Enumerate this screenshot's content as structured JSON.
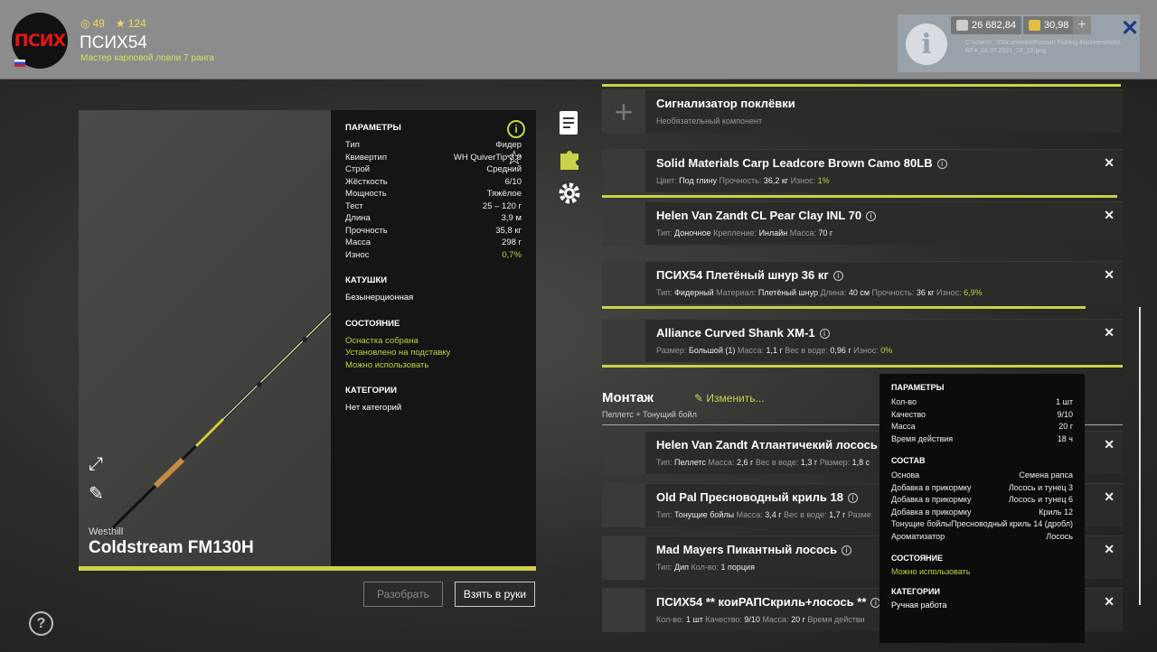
{
  "header": {
    "avatar_text": "ПСИХ",
    "coins": "49",
    "stars": "124",
    "player_name": "ПСИХ54",
    "rank_text": "Мастер карповой ловли 7 ранга",
    "silver": "26 682,84",
    "gold": "30,98",
    "plus": "+",
    "close": "✕",
    "info_glyph": "i",
    "path_text": "C:\\Users\\...\\Documents\\Russian Fishing 4\\screenshots\\ RF4_28.07.2021_18_19.png"
  },
  "rod": {
    "brand": "Westhill",
    "model": "Coldstream FM130H",
    "params_title": "ПАРАМЕТРЫ",
    "params": [
      {
        "k": "Тип",
        "v": "Фидер"
      },
      {
        "k": "Квивертип",
        "v": "WH QuiverTip 3.0"
      },
      {
        "k": "Строй",
        "v": "Средний"
      },
      {
        "k": "Жёсткость",
        "v": "6/10"
      },
      {
        "k": "Мощность",
        "v": "Тяжёлое"
      },
      {
        "k": "Тест",
        "v": "25 – 120 г"
      },
      {
        "k": "Длина",
        "v": "3,9 м"
      },
      {
        "k": "Прочность",
        "v": "35,8 кг"
      },
      {
        "k": "Масса",
        "v": "298 г"
      },
      {
        "k": "Износ",
        "v": "0,7%"
      }
    ],
    "reels_title": "КАТУШКИ",
    "reels_value": "Безынерционная",
    "state_title": "СОСТОЯНИЕ",
    "state_lines": [
      "Оснастка собрана",
      "Установлено на подставку",
      "Можно использовать"
    ],
    "cat_title": "КАТЕГОРИИ",
    "cat_value": "Нет категорий",
    "info_glyph": "i",
    "star_glyph": "☆"
  },
  "buttons": {
    "disassemble": "Разобрать",
    "take": "Взять в руки",
    "help": "?"
  },
  "components": [
    {
      "name": "Сигнализатор поклёвки",
      "sub": [
        {
          "t": "Необязательный компонент"
        }
      ],
      "empty": true
    },
    {
      "name": "Solid Materials Carp Leadcore Brown Camo 80LB",
      "sub": [
        {
          "l": "Цвет: ",
          "v": "Под глину"
        },
        {
          "l": " Прочность: ",
          "v": "36,2 кг"
        },
        {
          "l": " Износ: ",
          "g": "1%"
        }
      ]
    },
    {
      "name": "Helen Van Zandt CL Pear Clay INL 70",
      "sub": [
        {
          "l": "Тип: ",
          "v": "Доночное"
        },
        {
          "l": " Крепление: ",
          "v": "Инлайн"
        },
        {
          "l": " Масса: ",
          "v": "70 г"
        }
      ]
    },
    {
      "name": "ПСИХ54 Плетёный шнур 36 кг",
      "sub": [
        {
          "l": "Тип: ",
          "v": "Фидерный"
        },
        {
          "l": " Материал: ",
          "v": "Плетёный шнур"
        },
        {
          "l": " Длина: ",
          "v": "40 см"
        },
        {
          "l": " Прочность: ",
          "v": "36 кг"
        },
        {
          "l": " Износ: ",
          "g": "6,9%"
        }
      ]
    },
    {
      "name": "Alliance Curved Shank XM-1",
      "sub": [
        {
          "l": "Размер: ",
          "v": "Большой (1)"
        },
        {
          "l": " Масса: ",
          "v": "1,1 г"
        },
        {
          "l": " Вес в воде: ",
          "v": "0,96 г"
        },
        {
          "l": " Износ: ",
          "g": "0%"
        }
      ]
    }
  ],
  "montage": {
    "title": "Монтаж",
    "subtitle": "Пеллетс + Тонущий бойл",
    "edit": "Изменить...",
    "items": [
      {
        "name": "Helen Van Zandt Атлантичекий лосось",
        "sub": [
          {
            "l": "Тип: ",
            "v": "Пеллетс"
          },
          {
            "l": " Масса: ",
            "v": "2,6 г"
          },
          {
            "l": " Вес в воде: ",
            "v": "1,3 г"
          },
          {
            "l": " Размер: ",
            "v": "1,8 с"
          }
        ]
      },
      {
        "name": "Old Pal Пресноводный криль 18",
        "sub": [
          {
            "l": "Тип: ",
            "v": "Тонущие бойлы"
          },
          {
            "l": " Масса: ",
            "v": "3,4 г"
          },
          {
            "l": " Вес в воде: ",
            "v": "1,7 г"
          },
          {
            "l": " Разме",
            "v": ""
          }
        ]
      },
      {
        "name": "Mad Mayers Пикантный лосось",
        "sub": [
          {
            "l": "Тип: ",
            "v": "Дип"
          },
          {
            "l": " Кол-во: ",
            "v": "1 порция"
          }
        ]
      },
      {
        "name": "ПСИХ54 ** коиРАПСкриль+лосось **",
        "sub": [
          {
            "l": "Кол-во: ",
            "v": "1 шт"
          },
          {
            "l": " Качество: ",
            "v": "9/10"
          },
          {
            "l": " Масса: ",
            "v": "20 г"
          },
          {
            "l": " Время действи",
            "v": ""
          }
        ]
      }
    ]
  },
  "tooltip": {
    "params_title": "ПАРАМЕТРЫ",
    "params": [
      {
        "k": "Кол-во",
        "v": "1 шт"
      },
      {
        "k": "Качество",
        "v": "9/10"
      },
      {
        "k": "Масса",
        "v": "20 г"
      },
      {
        "k": "Время действия",
        "v": "18 ч"
      }
    ],
    "comp_title": "СОСТАВ",
    "comp": [
      {
        "k": "Основа",
        "v": "Семена рапса"
      },
      {
        "k": "Добавка в прикормку",
        "v": "Лосось и тунец 3"
      },
      {
        "k": "Добавка в прикормку",
        "v": "Лосось и тунец 6"
      },
      {
        "k": "Добавка в прикормку",
        "v": "Криль 12"
      },
      {
        "k": "Тонущие бойлы",
        "v": "Пресноводный криль 14 (дробл)"
      },
      {
        "k": "Ароматизатор",
        "v": "Лосось"
      }
    ],
    "state_title": "СОСТОЯНИЕ",
    "state_value": "Можно использовать",
    "cat_title": "КАТЕГОРИИ",
    "cat_value": "Ручная работа"
  },
  "colors": {
    "accent": "#c9d24a",
    "green_text": "#b6d640"
  }
}
